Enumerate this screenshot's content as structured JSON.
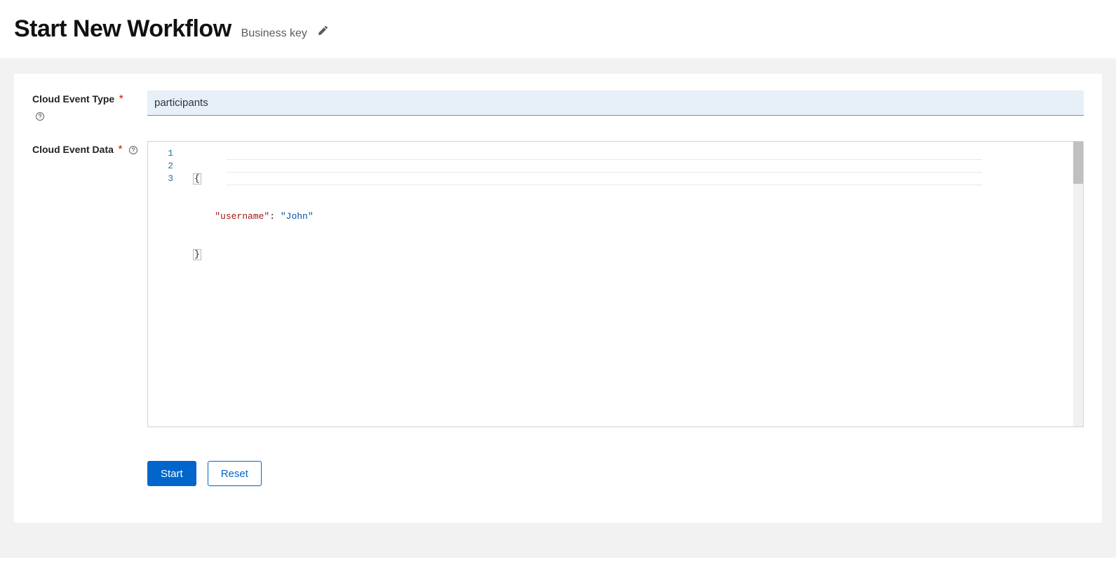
{
  "header": {
    "title": "Start New Workflow",
    "business_key_label": "Business key"
  },
  "form": {
    "event_type": {
      "label": "Cloud Event Type",
      "value": "participants",
      "required_marker": "*"
    },
    "event_data": {
      "label": "Cloud Event Data",
      "required_marker": "*",
      "gutter": [
        "1",
        "2",
        "3"
      ],
      "code": {
        "line1_brace_open": "{",
        "line2_key_quoted": "\"username\"",
        "line2_colon_sp": ": ",
        "line2_value_quoted": "\"John\"",
        "line3_brace_close": "}"
      }
    }
  },
  "buttons": {
    "start": "Start",
    "reset": "Reset"
  }
}
